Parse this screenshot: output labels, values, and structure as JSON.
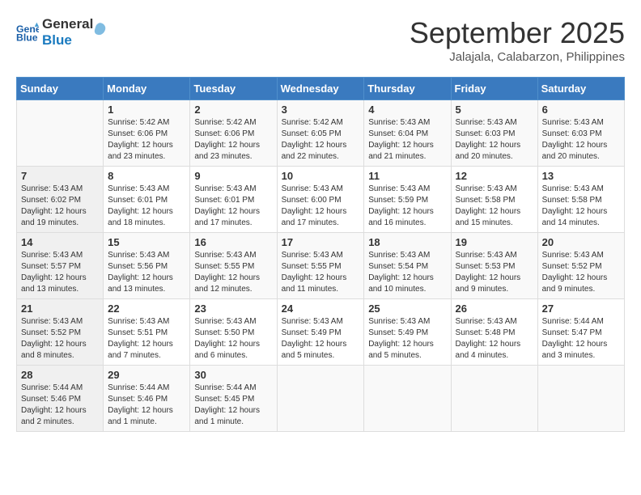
{
  "header": {
    "logo_line1": "General",
    "logo_line2": "Blue",
    "month": "September 2025",
    "location": "Jalajala, Calabarzon, Philippines"
  },
  "weekdays": [
    "Sunday",
    "Monday",
    "Tuesday",
    "Wednesday",
    "Thursday",
    "Friday",
    "Saturday"
  ],
  "weeks": [
    [
      {
        "day": "",
        "info": ""
      },
      {
        "day": "1",
        "info": "Sunrise: 5:42 AM\nSunset: 6:06 PM\nDaylight: 12 hours\nand 23 minutes."
      },
      {
        "day": "2",
        "info": "Sunrise: 5:42 AM\nSunset: 6:06 PM\nDaylight: 12 hours\nand 23 minutes."
      },
      {
        "day": "3",
        "info": "Sunrise: 5:42 AM\nSunset: 6:05 PM\nDaylight: 12 hours\nand 22 minutes."
      },
      {
        "day": "4",
        "info": "Sunrise: 5:43 AM\nSunset: 6:04 PM\nDaylight: 12 hours\nand 21 minutes."
      },
      {
        "day": "5",
        "info": "Sunrise: 5:43 AM\nSunset: 6:03 PM\nDaylight: 12 hours\nand 20 minutes."
      },
      {
        "day": "6",
        "info": "Sunrise: 5:43 AM\nSunset: 6:03 PM\nDaylight: 12 hours\nand 20 minutes."
      }
    ],
    [
      {
        "day": "7",
        "info": "Sunrise: 5:43 AM\nSunset: 6:02 PM\nDaylight: 12 hours\nand 19 minutes."
      },
      {
        "day": "8",
        "info": "Sunrise: 5:43 AM\nSunset: 6:01 PM\nDaylight: 12 hours\nand 18 minutes."
      },
      {
        "day": "9",
        "info": "Sunrise: 5:43 AM\nSunset: 6:01 PM\nDaylight: 12 hours\nand 17 minutes."
      },
      {
        "day": "10",
        "info": "Sunrise: 5:43 AM\nSunset: 6:00 PM\nDaylight: 12 hours\nand 17 minutes."
      },
      {
        "day": "11",
        "info": "Sunrise: 5:43 AM\nSunset: 5:59 PM\nDaylight: 12 hours\nand 16 minutes."
      },
      {
        "day": "12",
        "info": "Sunrise: 5:43 AM\nSunset: 5:58 PM\nDaylight: 12 hours\nand 15 minutes."
      },
      {
        "day": "13",
        "info": "Sunrise: 5:43 AM\nSunset: 5:58 PM\nDaylight: 12 hours\nand 14 minutes."
      }
    ],
    [
      {
        "day": "14",
        "info": "Sunrise: 5:43 AM\nSunset: 5:57 PM\nDaylight: 12 hours\nand 13 minutes."
      },
      {
        "day": "15",
        "info": "Sunrise: 5:43 AM\nSunset: 5:56 PM\nDaylight: 12 hours\nand 13 minutes."
      },
      {
        "day": "16",
        "info": "Sunrise: 5:43 AM\nSunset: 5:55 PM\nDaylight: 12 hours\nand 12 minutes."
      },
      {
        "day": "17",
        "info": "Sunrise: 5:43 AM\nSunset: 5:55 PM\nDaylight: 12 hours\nand 11 minutes."
      },
      {
        "day": "18",
        "info": "Sunrise: 5:43 AM\nSunset: 5:54 PM\nDaylight: 12 hours\nand 10 minutes."
      },
      {
        "day": "19",
        "info": "Sunrise: 5:43 AM\nSunset: 5:53 PM\nDaylight: 12 hours\nand 9 minutes."
      },
      {
        "day": "20",
        "info": "Sunrise: 5:43 AM\nSunset: 5:52 PM\nDaylight: 12 hours\nand 9 minutes."
      }
    ],
    [
      {
        "day": "21",
        "info": "Sunrise: 5:43 AM\nSunset: 5:52 PM\nDaylight: 12 hours\nand 8 minutes."
      },
      {
        "day": "22",
        "info": "Sunrise: 5:43 AM\nSunset: 5:51 PM\nDaylight: 12 hours\nand 7 minutes."
      },
      {
        "day": "23",
        "info": "Sunrise: 5:43 AM\nSunset: 5:50 PM\nDaylight: 12 hours\nand 6 minutes."
      },
      {
        "day": "24",
        "info": "Sunrise: 5:43 AM\nSunset: 5:49 PM\nDaylight: 12 hours\nand 5 minutes."
      },
      {
        "day": "25",
        "info": "Sunrise: 5:43 AM\nSunset: 5:49 PM\nDaylight: 12 hours\nand 5 minutes."
      },
      {
        "day": "26",
        "info": "Sunrise: 5:43 AM\nSunset: 5:48 PM\nDaylight: 12 hours\nand 4 minutes."
      },
      {
        "day": "27",
        "info": "Sunrise: 5:44 AM\nSunset: 5:47 PM\nDaylight: 12 hours\nand 3 minutes."
      }
    ],
    [
      {
        "day": "28",
        "info": "Sunrise: 5:44 AM\nSunset: 5:46 PM\nDaylight: 12 hours\nand 2 minutes."
      },
      {
        "day": "29",
        "info": "Sunrise: 5:44 AM\nSunset: 5:46 PM\nDaylight: 12 hours\nand 1 minute."
      },
      {
        "day": "30",
        "info": "Sunrise: 5:44 AM\nSunset: 5:45 PM\nDaylight: 12 hours\nand 1 minute."
      },
      {
        "day": "",
        "info": ""
      },
      {
        "day": "",
        "info": ""
      },
      {
        "day": "",
        "info": ""
      },
      {
        "day": "",
        "info": ""
      }
    ]
  ]
}
